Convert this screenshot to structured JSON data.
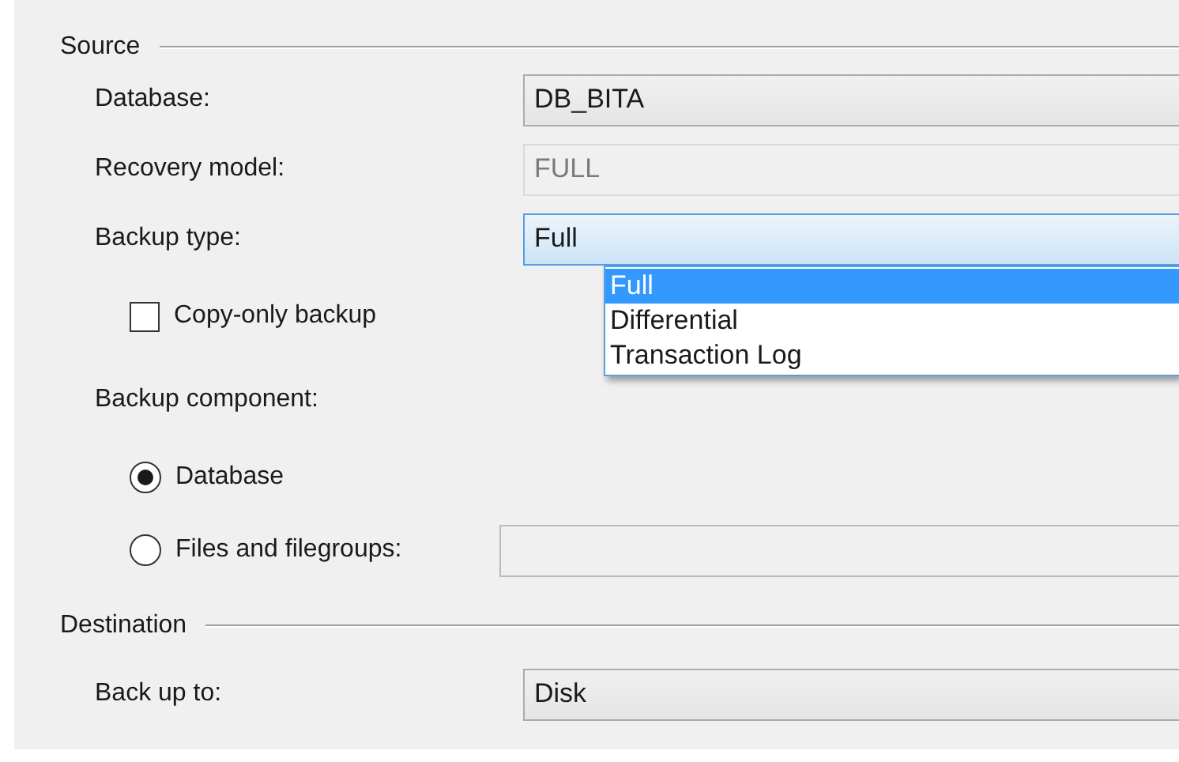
{
  "source": {
    "title": "Source",
    "fields": [
      {
        "kind": "combo",
        "label": "Database:",
        "value": "DB_BITA"
      },
      {
        "kind": "text",
        "label": "Recovery model:",
        "value": "FULL",
        "disabled": true
      },
      {
        "kind": "combo",
        "label": "Backup type:",
        "value": "Full",
        "expanded": true,
        "options": [
          {
            "label": "Full",
            "selected": true
          },
          {
            "label": "Differential",
            "selected": false
          },
          {
            "label": "Transaction Log",
            "selected": false
          }
        ]
      }
    ],
    "copy_only": {
      "label": "Copy-only backup",
      "checked": false
    },
    "component": {
      "label": "Backup component:",
      "options": [
        {
          "label": "Database",
          "selected": true
        },
        {
          "label": "Files and filegroups:",
          "selected": false
        }
      ],
      "filegroups_field": {
        "disabled": true
      }
    }
  },
  "destination": {
    "title": "Destination",
    "fields": [
      {
        "kind": "combo",
        "label": "Back up to:",
        "value": "Disk"
      }
    ]
  }
}
